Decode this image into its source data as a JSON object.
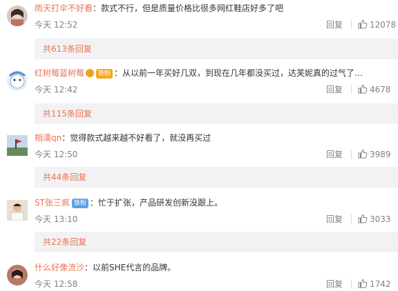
{
  "comments": [
    {
      "username": "雨天打伞不好看",
      "badge": "",
      "text": "：款式不行，但是质量价格比很多网红鞋店好多了吧",
      "time": "今天 12:52",
      "reply_label": "回复",
      "likes": "12078",
      "more_replies": "共613条回复",
      "avatar_icon": "avatar-girl"
    },
    {
      "username": "红树莓蓝树莓",
      "badge": "铁粉",
      "text": "：从以前一年买好几双，到现在几年都没买过，达芙妮真的过气了…",
      "time": "今天 12:42",
      "reply_label": "回复",
      "likes": "4678",
      "more_replies": "共115条回复",
      "avatar_icon": "avatar-cartoon"
    },
    {
      "username": "相濡qn",
      "badge": "",
      "text": "：觉得款式越来越不好看了，就没再买过",
      "time": "今天 12:50",
      "reply_label": "回复",
      "likes": "3989",
      "more_replies": "共44条回复",
      "avatar_icon": "avatar-landscape"
    },
    {
      "username": "ST张三疯",
      "badge": "铁粉",
      "text": "：忙于扩张，产品研发创新没跟上。",
      "time": "今天 13:10",
      "reply_label": "回复",
      "likes": "3033",
      "more_replies": "共22条回复",
      "avatar_icon": "avatar-person"
    },
    {
      "username": "什么好像流沙",
      "badge": "",
      "text": "：以前SHE代言的品牌。",
      "time": "今天 12:58",
      "reply_label": "回复",
      "likes": "1742",
      "avatar_icon": "avatar-photo"
    }
  ],
  "colors": {
    "username": "#eb7350",
    "text": "#333333",
    "meta": "#808080",
    "more_bg": "#f2f2f5",
    "badge_gold": "#f5a623",
    "badge_blue": "#5aa0e6"
  }
}
